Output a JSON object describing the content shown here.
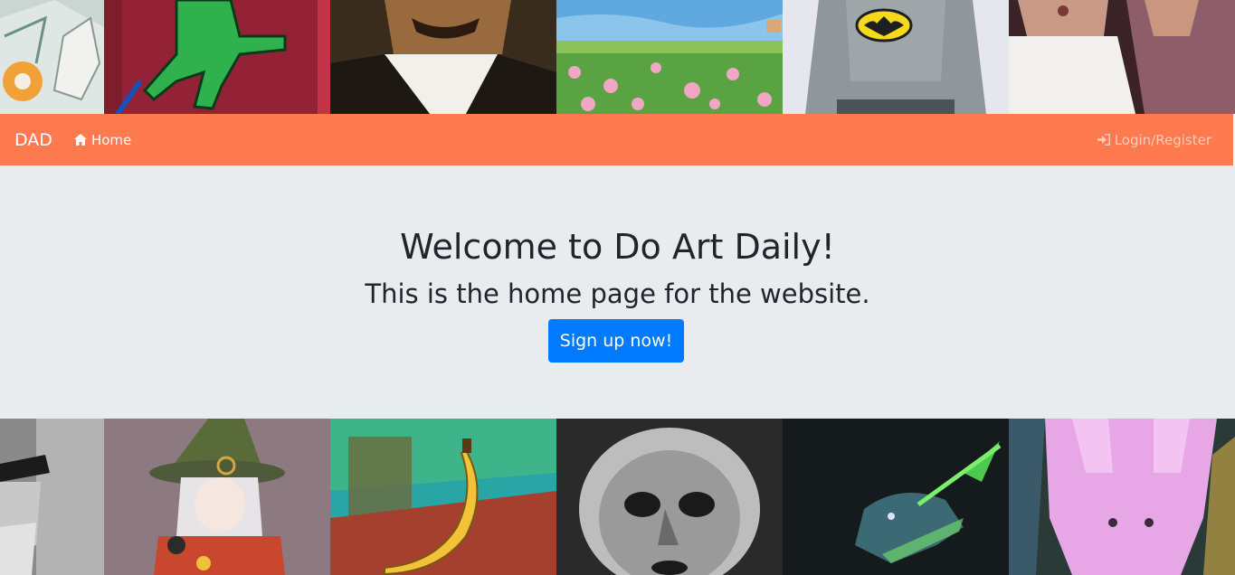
{
  "navbar": {
    "brand": "DAD",
    "home_label": "Home",
    "login_label": "Login/Register",
    "color": "#ff7a4f"
  },
  "hero": {
    "title": "Welcome to Do Art Daily!",
    "subtitle": "This is the home page for the website.",
    "cta_label": "Sign up now!",
    "background": "#e9ecef",
    "button_color": "#007bff"
  },
  "gallery": {
    "top": [
      "sketch-artwork",
      "green-cat-artwork",
      "mustache-portrait",
      "flower-field-painting",
      "batman-figure",
      "two-women-painting"
    ],
    "bottom": [
      "bearded-man-drawing",
      "witch-girl-illustration",
      "banana-painting",
      "monochrome-face-drawing",
      "dragon-illustration",
      "pink-rabbit-painting"
    ]
  },
  "icons": {
    "home": "home-icon",
    "login": "sign-in-icon"
  }
}
